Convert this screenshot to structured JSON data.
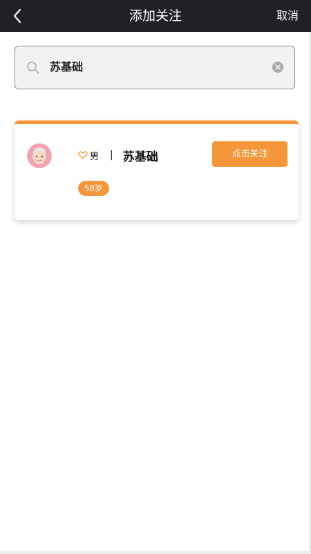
{
  "header": {
    "title": "添加关注",
    "cancel_label": "取消",
    "back_icon": "chevron-left-icon"
  },
  "search": {
    "value": "苏基础",
    "icon": "search-icon",
    "clear_icon": "clear-icon"
  },
  "result": {
    "gender": "男",
    "separator": "|",
    "name": "苏基础",
    "age": "58岁",
    "follow_label": "点击关注",
    "heart_icon": "heart-icon",
    "avatar": "avatar-elderly-icon"
  },
  "colors": {
    "topbar": "#1f2126",
    "accent": "#f5963a",
    "search_bg": "#f2f2f2"
  }
}
